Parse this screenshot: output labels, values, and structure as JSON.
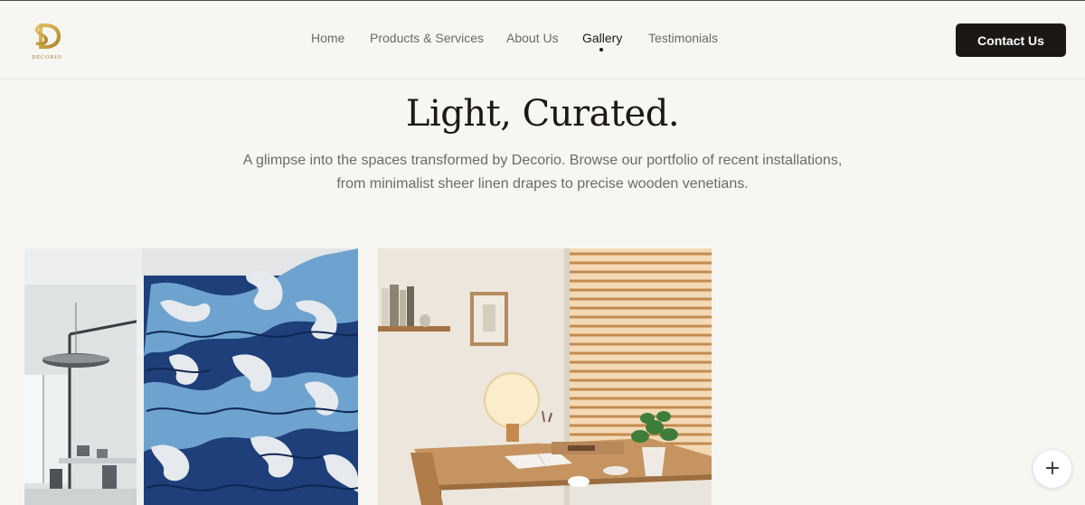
{
  "brand": {
    "name": "DECORIO",
    "logo_color": "#c9a23a"
  },
  "nav": {
    "items": [
      {
        "label": "Home"
      },
      {
        "label": "Products & Services"
      },
      {
        "label": "About Us"
      },
      {
        "label": "Gallery",
        "active": true
      },
      {
        "label": "Testimonials"
      }
    ]
  },
  "header": {
    "cta_label": "Contact Us"
  },
  "hero": {
    "title": "Light, Curated.",
    "description_line1": "A glimpse into the spaces transformed by Decorio. Browse our portfolio of recent installations,",
    "description_line2": "from minimalist sheer linen drapes to precise wooden venetians."
  },
  "gallery": {
    "items": [
      {
        "subject": "office-wave-mural"
      },
      {
        "subject": "study-wooden-venetian-blinds"
      }
    ]
  },
  "fab": {
    "icon": "plus-icon",
    "glyph": "+"
  },
  "colors": {
    "background": "#f7f6f3",
    "primary": "#1b1816",
    "muted_text": "#6d6a66",
    "accent_gold": "#c9a23a"
  }
}
